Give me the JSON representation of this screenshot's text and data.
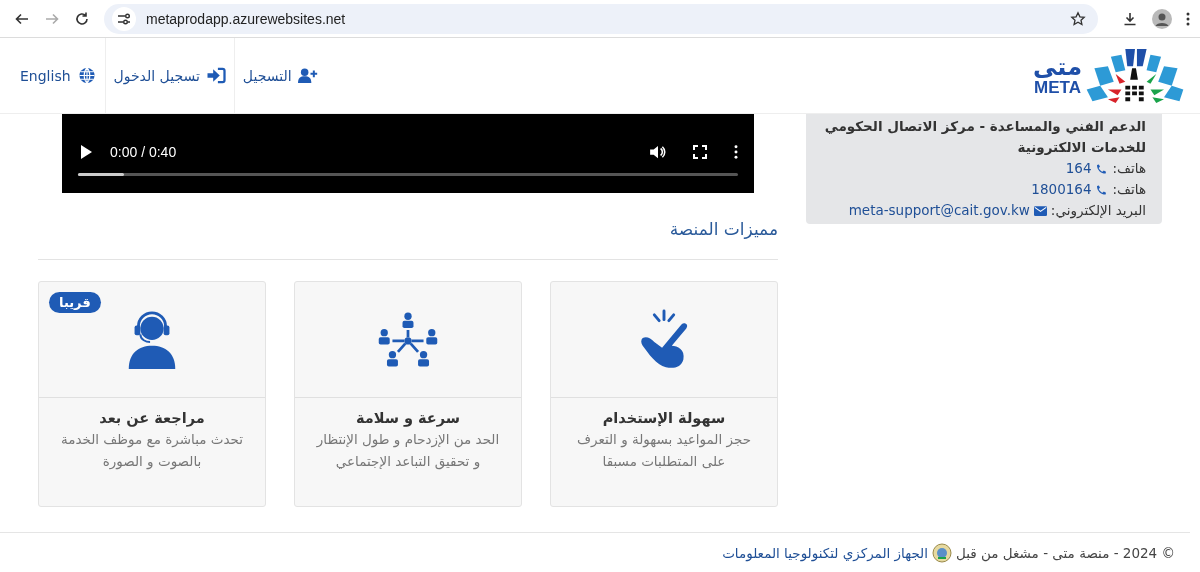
{
  "browser": {
    "url": "metaprodapp.azurewebsites.net"
  },
  "header": {
    "logo": {
      "arabic": "متى",
      "latin": "META"
    },
    "nav": [
      {
        "label": "التسجيل",
        "kind": "register"
      },
      {
        "label": "تسجيل الدخول",
        "kind": "login"
      },
      {
        "label": "English",
        "kind": "language"
      }
    ]
  },
  "support": {
    "title": "الدعم الفني والمساعدة - مركز الاتصال الحكومي للخدمات الالكترونية",
    "lines": [
      {
        "label": "هاتف:",
        "value": "164",
        "kind": "phone"
      },
      {
        "label": "هاتف:",
        "value": "1800164",
        "kind": "phone"
      },
      {
        "label": "البريد الإلكتروني:",
        "value": "meta-support@cait.gov.kw",
        "kind": "email"
      }
    ]
  },
  "video": {
    "time": "0:00 / 0:40",
    "level": 0.07
  },
  "features": {
    "heading": "مميزات المنصة",
    "cards": [
      {
        "title": "سهولة الإستخدام",
        "description": "حجز المواعيد بسهولة و التعرف على المتطلبات مسبقا",
        "kind": "tap"
      },
      {
        "title": "سرعة و سلامة",
        "description": "الحد من الإزدحام و طول الإنتظار و تحقيق التباعد الإجتماعي",
        "kind": "network"
      },
      {
        "title": "مراجعة عن بعد",
        "description": "تحدث مباشرة مع موظف الخدمة بالصوت و الصورة",
        "kind": "support",
        "badge": "قريبا"
      }
    ]
  },
  "footer": {
    "text": "© 2024 - منصة متى - مشغل من قبل",
    "link": "الجهاز المركزي لتكنولوجيا المعلومات"
  }
}
